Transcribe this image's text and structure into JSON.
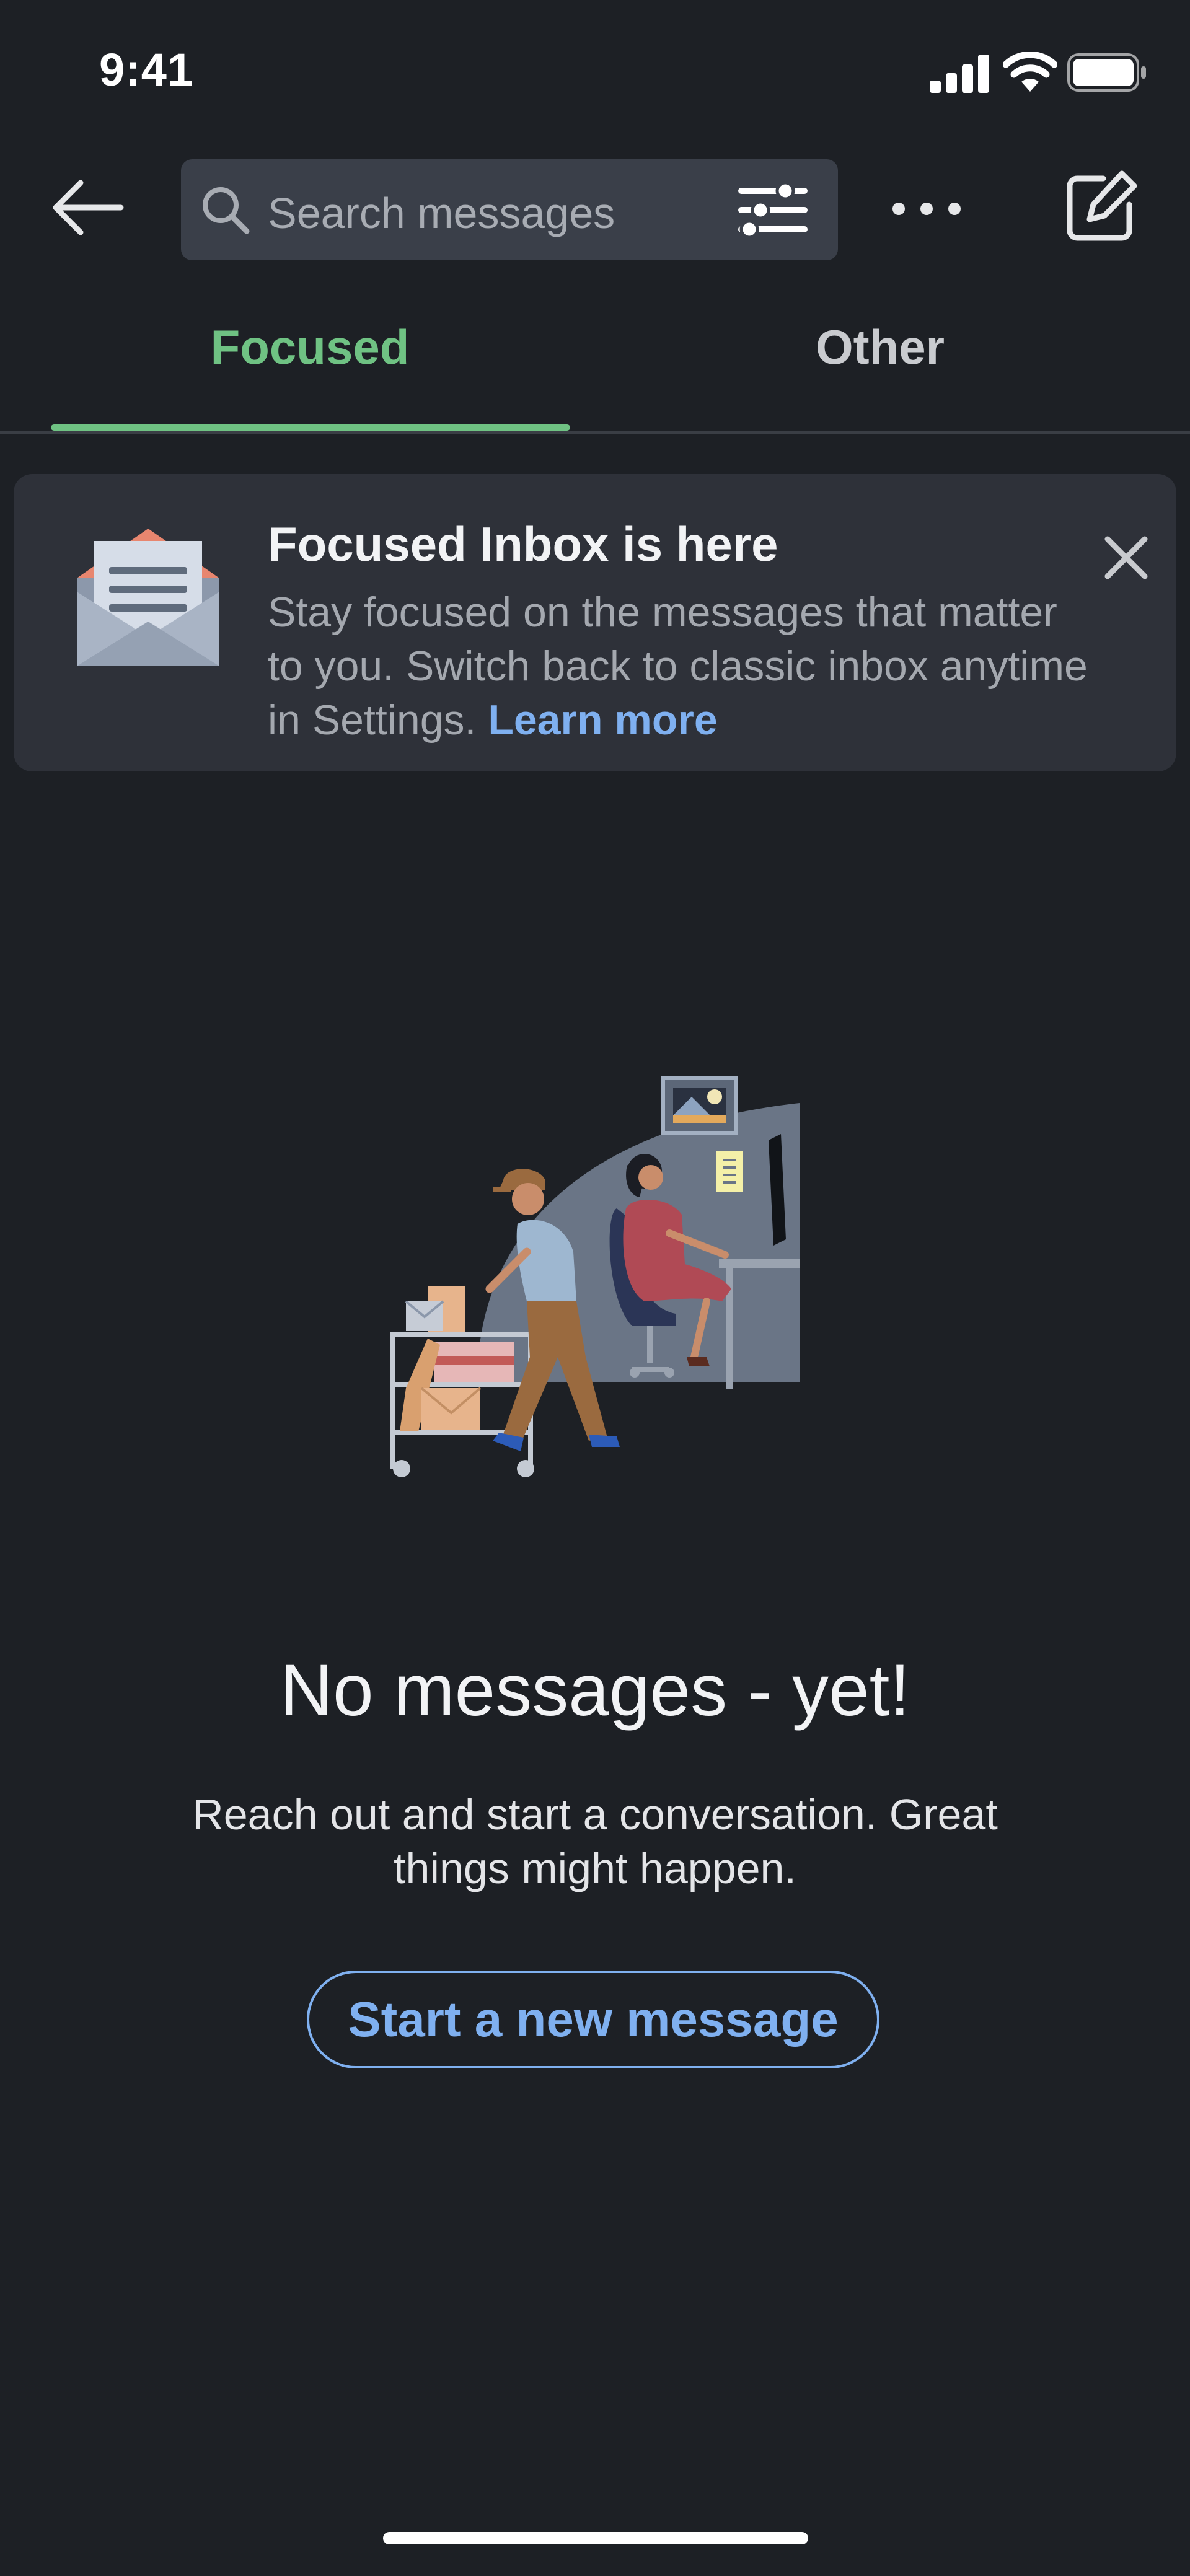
{
  "status_bar": {
    "time": "9:41",
    "icons": [
      "signal-icon",
      "wifi-icon",
      "battery-icon"
    ]
  },
  "header": {
    "back_icon": "back-arrow-icon",
    "search": {
      "placeholder": "Search messages",
      "icon": "search-icon",
      "filter_icon": "filter-sliders-icon"
    },
    "more_icon": "more-horizontal-icon",
    "compose_icon": "compose-icon"
  },
  "tabs": [
    {
      "label": "Focused",
      "selected": true
    },
    {
      "label": "Other",
      "selected": false
    }
  ],
  "banner": {
    "title": "Focused Inbox is here",
    "body": "Stay focused on the messages that matter to you. Switch back to classic inbox anytime in Settings.",
    "link": "Learn more",
    "icon": "open-envelope-icon",
    "close_icon": "close-icon"
  },
  "empty_state": {
    "illustration": "mail-delivery-illustration",
    "title": "No messages - yet!",
    "body": "Reach out and start a conversation. Great things might happen.",
    "button": "Start a new message"
  },
  "colors": {
    "background": "#1d2025",
    "accent_green": "#6fc283",
    "link_blue": "#7fb0f0",
    "banner_bg": "#2e3139",
    "search_bg": "#3a3f49"
  }
}
